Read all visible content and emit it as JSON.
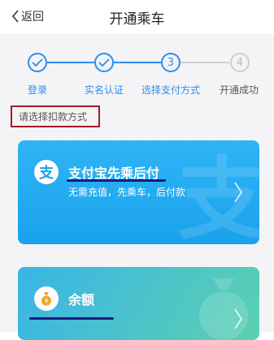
{
  "header": {
    "back_label": "返回",
    "title": "开通乘车"
  },
  "steps": [
    {
      "label": "登录",
      "state": "done",
      "marker": "✓"
    },
    {
      "label": "实名认证",
      "state": "done",
      "marker": "✓"
    },
    {
      "label": "选择支付方式",
      "state": "current",
      "marker": "3"
    },
    {
      "label": "开通成功",
      "state": "pending",
      "marker": "4"
    }
  ],
  "hint": "请选择扣款方式",
  "payment_options": {
    "alipay": {
      "logo_char": "支",
      "title": "支付宝先乘后付",
      "subtitle": "无需充值，先乘车，后付款",
      "watermark_char": "支"
    },
    "balance": {
      "logo_char": "¥",
      "title": "余额"
    }
  },
  "colors": {
    "accent": "#2c8df0",
    "hint_border": "#a01d26",
    "annotation_underline": "#1c1a7e"
  }
}
